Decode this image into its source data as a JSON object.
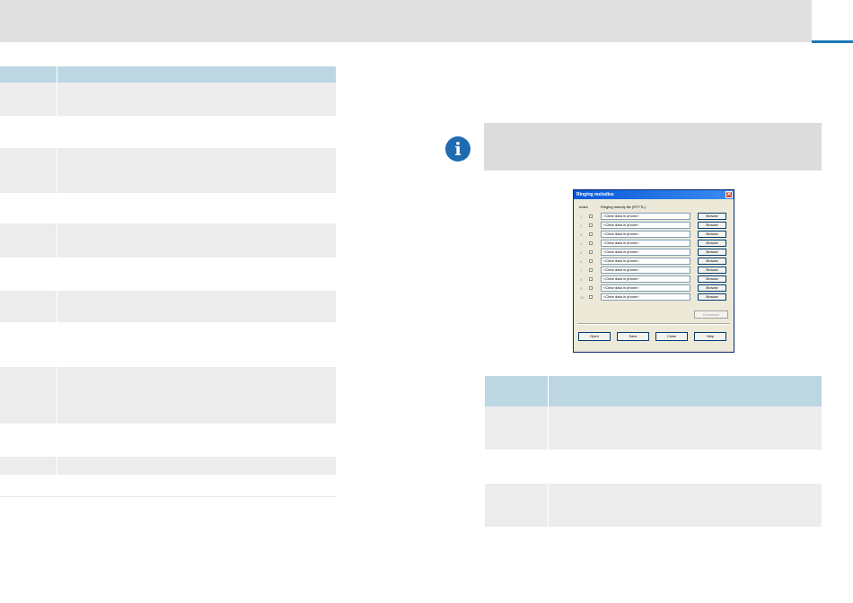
{
  "header": {
    "accent_color": "#1f78b4"
  },
  "info": {
    "icon": "info-icon",
    "glyph": "i"
  },
  "dialog": {
    "title": "Ringing melodies",
    "close_glyph": "✕",
    "index_header": "Index",
    "file_header": "Ringing melody file (RTTTL)",
    "rows": [
      {
        "index": "1",
        "value": "<Clear data in phone>",
        "browse": "Browse"
      },
      {
        "index": "2",
        "value": "<Clear data in phone>",
        "browse": "Browse"
      },
      {
        "index": "3",
        "value": "<Clear data in phone>",
        "browse": "Browse"
      },
      {
        "index": "4",
        "value": "<Clear data in phone>",
        "browse": "Browse"
      },
      {
        "index": "5",
        "value": "<Clear data in phone>",
        "browse": "Browse"
      },
      {
        "index": "6",
        "value": "<Clear data in phone>",
        "browse": "Browse"
      },
      {
        "index": "7",
        "value": "<Clear data in phone>",
        "browse": "Browse"
      },
      {
        "index": "8",
        "value": "<Clear data in phone>",
        "browse": "Browse"
      },
      {
        "index": "9",
        "value": "<Clear data in phone>",
        "browse": "Browse"
      },
      {
        "index": "10",
        "value": "<Clear data in phone>",
        "browse": "Browse"
      }
    ],
    "download": "Download",
    "buttons": {
      "open": "Open",
      "save": "Save",
      "close": "Close",
      "help": "Help"
    }
  }
}
